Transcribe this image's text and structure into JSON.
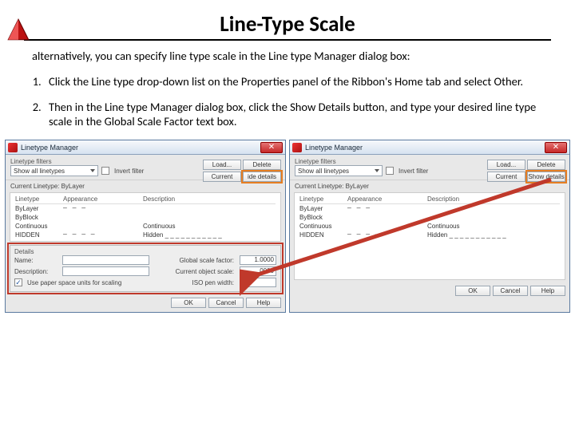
{
  "page": {
    "title": "Line-Type Scale",
    "intro": "alternatively, you can specify line type scale in the Line type Manager dialog box:",
    "steps": [
      "Click the Line type drop-down list on the Properties panel of the Ribbon's Home tab and select Other.",
      "Then in the Line type Manager dialog box, click the Show Details button, and type your desired line type scale in the Global Scale Factor text box."
    ]
  },
  "dialog": {
    "title": "Linetype Manager",
    "filters_label": "Linetype filters",
    "filter_value": "Show all linetypes",
    "invert_label": "Invert filter",
    "load_btn": "Load...",
    "delete_btn": "Delete",
    "current_btn": "Current",
    "hide_details_btn": "ide details",
    "show_details_btn": "Show details",
    "current_linetype": "Current Linetype: ByLayer",
    "cols": {
      "name": "Linetype",
      "appearance": "Appearance",
      "description": "Description"
    },
    "rows": [
      {
        "name": "ByLayer",
        "pattern": "— — —",
        "desc": ""
      },
      {
        "name": "ByBlock",
        "pattern": "",
        "desc": ""
      },
      {
        "name": "Continuous",
        "pattern": "",
        "desc": "Continuous"
      },
      {
        "name": "HIDDEN",
        "pattern": "— — — —",
        "desc": "Hidden _ _ _ _ _ _ _ _ _ _ _"
      }
    ],
    "details": {
      "section": "Details",
      "name_label": "Name:",
      "desc_label": "Description:",
      "use_paper": "Use paper space units for scaling",
      "global_label": "Global scale factor:",
      "global_value": "1.0000",
      "object_label": "Current object scale:",
      "object_value": ".0000",
      "iso_label": "ISO pen width:"
    },
    "ok": "OK",
    "cancel": "Cancel",
    "help": "Help"
  }
}
